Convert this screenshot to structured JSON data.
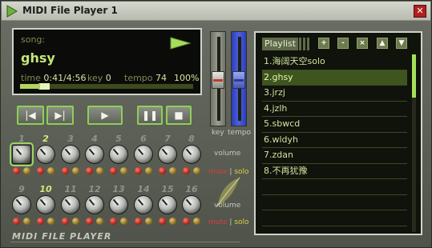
{
  "window": {
    "title": "MIDI File Player 1",
    "close_glyph": "✕"
  },
  "display": {
    "song_label": "song:",
    "song_name": "ghsy",
    "time_label": "time",
    "time_value": "0:41/4:56",
    "key_label": "key",
    "key_value": "0",
    "tempo_label": "tempo",
    "tempo_value": "74",
    "tempo_percent": "100%",
    "progress_fraction": 0.138
  },
  "transport": {
    "prev": "|◀",
    "next": "▶|",
    "play": "▶",
    "pause": "❚❚",
    "stop": "■"
  },
  "channels": {
    "row1": [
      "1",
      "2",
      "3",
      "4",
      "5",
      "6",
      "7",
      "8"
    ],
    "row2": [
      "9",
      "10",
      "11",
      "12",
      "13",
      "14",
      "15",
      "16"
    ],
    "active_row1": "2",
    "active_row2": "10"
  },
  "labels": {
    "volume1": "volume",
    "volume2": "volume",
    "mute": "mute",
    "separator": "|",
    "solo": "solo",
    "key_slider": "key",
    "tempo_slider": "tempo"
  },
  "sliders": {
    "key_level": 0.5,
    "tempo_level": 0.5
  },
  "playlist": {
    "title": "Playlist",
    "buttons": [
      "+",
      "-",
      "×",
      "▲",
      "▼"
    ],
    "items": [
      "1.海阔天空solo",
      "2.ghsy",
      "3.jrzj",
      "4.jzlh",
      "5.sbwcd",
      "6.wldyh",
      "7.zdan",
      "8.不再犹豫"
    ],
    "selected_index": 1,
    "empty_rows": 3
  },
  "brand": "MIDI FILE PLAYER",
  "colors": {
    "accent_green": "#9cd45e",
    "lcd_text": "#c6e676",
    "mute_red": "#e03a3a",
    "solo_yellow": "#d8cf4a",
    "tempo_blue": "#4d62dd"
  }
}
